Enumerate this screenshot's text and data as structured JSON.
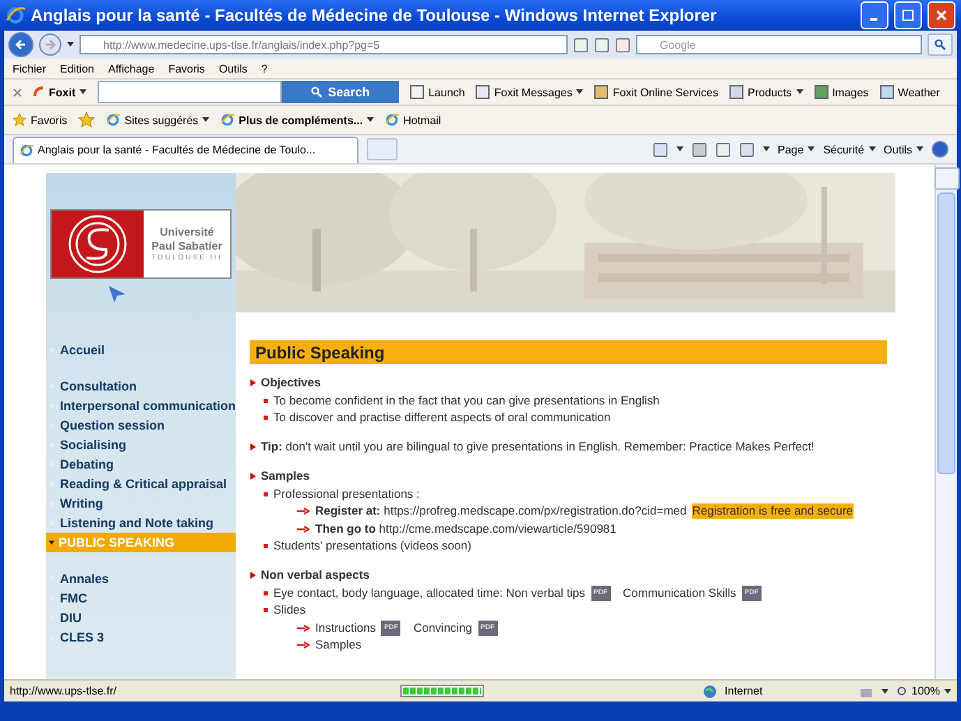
{
  "window": {
    "title": "Anglais pour la santé - Facultés de Médecine de Toulouse - Windows Internet Explorer"
  },
  "address_bar": {
    "url": "http://www.medecine.ups-tlse.fr/anglais/index.php?pg=5",
    "search_placeholder": "Google"
  },
  "menu_bar": [
    "Fichier",
    "Edition",
    "Affichage",
    "Favoris",
    "Outils",
    "?"
  ],
  "foxit_toolbar": {
    "logo": "Foxit",
    "search_button": "Search",
    "items": [
      {
        "label": "Launch",
        "dropdown": false
      },
      {
        "label": "Foxit Messages",
        "dropdown": true
      },
      {
        "label": "Foxit Online Services",
        "dropdown": false
      },
      {
        "label": "Products",
        "dropdown": true
      },
      {
        "label": "Images",
        "dropdown": false
      },
      {
        "label": "Weather",
        "dropdown": false
      }
    ]
  },
  "favorites_bar": {
    "favorites": "Favoris",
    "items": [
      {
        "label": "Sites suggérés",
        "dropdown": true,
        "bold": false
      },
      {
        "label": "Plus de compléments...",
        "dropdown": true,
        "bold": true
      },
      {
        "label": "Hotmail",
        "dropdown": false,
        "bold": false
      }
    ]
  },
  "tabs": [
    {
      "label": "Anglais pour la santé - Facultés de Médecine de Toulo...",
      "selected": true
    }
  ],
  "command_bar": [
    "Page",
    "Sécurité",
    "Outils"
  ],
  "logo": {
    "line1": "Université",
    "line2": "Paul Sabatier",
    "line3": "TOULOUSE III"
  },
  "sidebar": {
    "groups": [
      [
        {
          "label": "Accueil",
          "selected": false
        }
      ],
      [
        {
          "label": "Consultation",
          "selected": false
        },
        {
          "label": "Interpersonal communication",
          "selected": false
        },
        {
          "label": "Question session",
          "selected": false
        },
        {
          "label": "Socialising",
          "selected": false
        },
        {
          "label": "Debating",
          "selected": false
        },
        {
          "label": "Reading & Critical appraisal",
          "selected": false
        },
        {
          "label": "Writing",
          "selected": false
        },
        {
          "label": "Listening and Note taking",
          "selected": false
        },
        {
          "label": "PUBLIC SPEAKING",
          "selected": true
        }
      ],
      [
        {
          "label": "Annales",
          "selected": false
        },
        {
          "label": "FMC",
          "selected": false
        },
        {
          "label": "DIU",
          "selected": false
        },
        {
          "label": "CLES 3",
          "selected": false
        }
      ]
    ]
  },
  "page": {
    "heading": "Public Speaking",
    "sections": [
      {
        "title": "Objectives",
        "lines": [
          {
            "kind": "bullet",
            "parts": [
              {
                "text": "To become confident in the fact that you can give presentations in English"
              }
            ]
          },
          {
            "kind": "bullet",
            "parts": [
              {
                "text": "To discover and practise different aspects of oral communication"
              }
            ]
          }
        ]
      },
      {
        "title": "**Tip:** don't wait until you are bilingual to give presentations in English. Remember: Practice Makes Perfect!"
      },
      {
        "title": "Samples",
        "lines": [
          {
            "kind": "bullet",
            "parts": [
              {
                "text": "Professional presentations :"
              }
            ]
          },
          {
            "kind": "arrow",
            "parts": [
              {
                "text": "**Register at:** https://profreg.medscape.com/px/registration.do?cid=med"
              },
              {
                "text": "Registration is free and secure",
                "highlight": true
              }
            ]
          },
          {
            "kind": "arrow",
            "parts": [
              {
                "text": "**Then go to** http://cme.medscape.com/viewarticle/590981"
              }
            ]
          },
          {
            "kind": "bullet",
            "parts": [
              {
                "text": "Students' presentations (videos soon)"
              }
            ]
          }
        ]
      },
      {
        "title": "Non verbal aspects",
        "lines": [
          {
            "kind": "bullet",
            "parts": [
              {
                "text": "Eye contact, body language, allocated time: Non verbal tips",
                "badge": "PDF"
              },
              {
                "text": "Communication Skills",
                "badge": "PDF"
              }
            ]
          },
          {
            "kind": "bullet",
            "parts": [
              {
                "text": "Slides"
              }
            ]
          },
          {
            "kind": "arrow",
            "parts": [
              {
                "text": "Instructions",
                "badge": "PDF"
              },
              {
                "text": "Convincing",
                "badge": "PDF"
              }
            ]
          },
          {
            "kind": "arrow",
            "parts": [
              {
                "text": "Samples"
              }
            ]
          }
        ]
      }
    ]
  },
  "status_bar": {
    "url": "http://www.ups-tlse.fr/",
    "progress": {
      "level": 1
    },
    "zone": "Internet",
    "zoom": "100%"
  }
}
